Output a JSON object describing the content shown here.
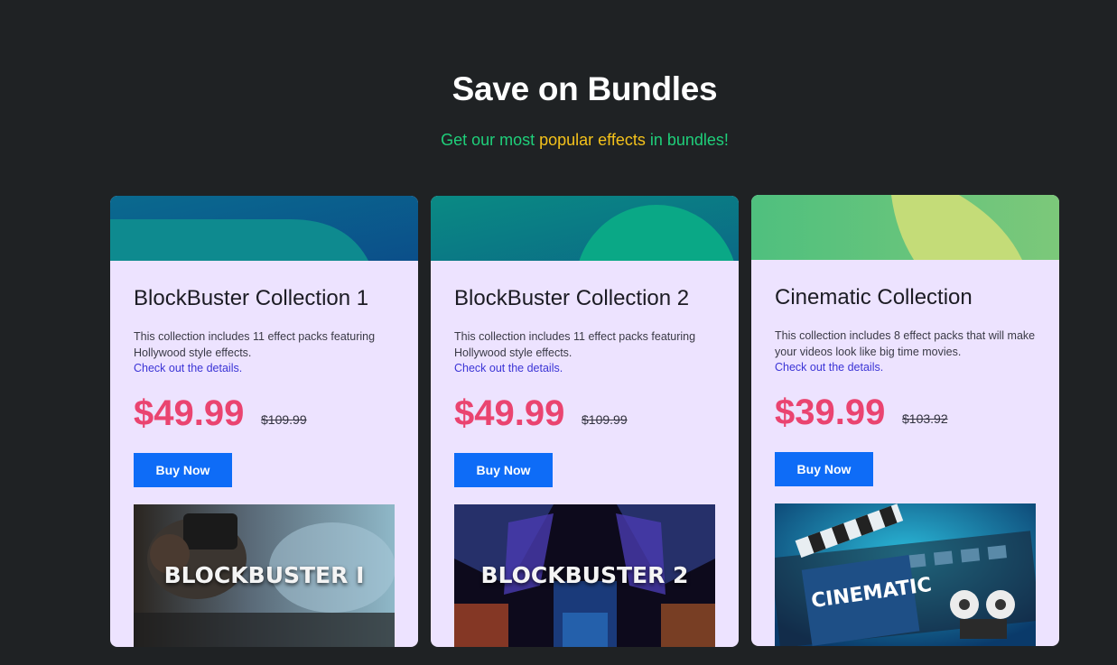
{
  "section": {
    "title": "Save on Bundles",
    "subtitle_pre": "Get our most ",
    "subtitle_highlight": "popular effects",
    "subtitle_post": " in bundles!"
  },
  "cards": [
    {
      "title": "BlockBuster Collection 1",
      "description": "This collection includes 11 effect packs featuring Hollywood style effects.",
      "link": "Check out the details.",
      "price": "$49.99",
      "old_price": "$109.99",
      "button": "Buy Now",
      "image_label": "BLOCKBUSTER I"
    },
    {
      "title": "BlockBuster Collection 2",
      "description": "This collection includes 11 effect packs featuring Hollywood style effects.",
      "link": "Check out the details.",
      "price": "$49.99",
      "old_price": "$109.99",
      "button": "Buy Now",
      "image_label": "BLOCKBUSTER 2"
    },
    {
      "title": "Cinematic Collection",
      "description": "This collection includes 8 effect packs that will make your videos look like big time movies.",
      "link": "Check out the details.",
      "price": "$39.99",
      "old_price": "$103.92",
      "button": "Buy Now",
      "image_label": "CINEMATIC"
    }
  ],
  "colors": {
    "background": "#1f2224",
    "card_bg": "#ede3ff",
    "price": "#ea4470",
    "button": "#0e6cf7",
    "subtitle": "#1fcf7a",
    "highlight": "#f4c21b",
    "link": "#3b34d6"
  }
}
